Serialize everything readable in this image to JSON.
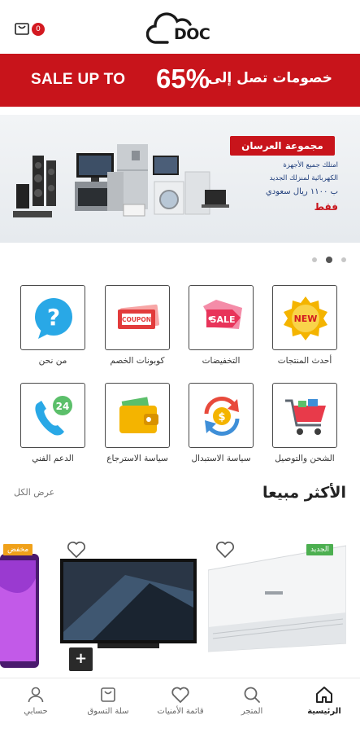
{
  "header": {
    "logo_text": "DOC",
    "cart_count": "0"
  },
  "promo": {
    "english": "SALE UP TO",
    "percent": "65%",
    "arabic": "خصومات تصل إلى"
  },
  "banner": {
    "title": "مجموعة العرسان",
    "line1": "امتلك جميع الأجهزة",
    "line2": "الكهربائية لمنزلك الجديد",
    "line3": "ب ١١٠٠ ريال سعودي",
    "line4": "فقط",
    "slides": 3,
    "active_slide": 2
  },
  "categories": [
    {
      "label": "أحدث المنتجات",
      "icon": "new-badge-icon"
    },
    {
      "label": "التخفيضات",
      "icon": "sale-tag-icon"
    },
    {
      "label": "كوبونات الخصم",
      "icon": "coupon-icon"
    },
    {
      "label": "من نحن",
      "icon": "question-icon"
    },
    {
      "label": "الشحن والتوصيل",
      "icon": "shopping-cart-icon"
    },
    {
      "label": "سياسة الاستبدال",
      "icon": "exchange-icon"
    },
    {
      "label": "سياسة الاسترجاع",
      "icon": "wallet-icon"
    },
    {
      "label": "الدعم الفني",
      "icon": "support-24-icon"
    }
  ],
  "best_sellers": {
    "title": "الأكثر مبيعا",
    "view_all": "عرض الكل"
  },
  "products": {
    "tag_new": "الجديد",
    "tag_sale": "مخفض",
    "add_symbol": "+"
  },
  "nav": {
    "home": "الرئيسية",
    "store": "المتجر",
    "wishlist": "قائمة الأمنيات",
    "cart": "سلة التسوق",
    "account": "حسابي"
  },
  "colors": {
    "brand_red": "#c8141b",
    "new_green": "#4caf50",
    "sale_orange": "#f0a11a"
  }
}
